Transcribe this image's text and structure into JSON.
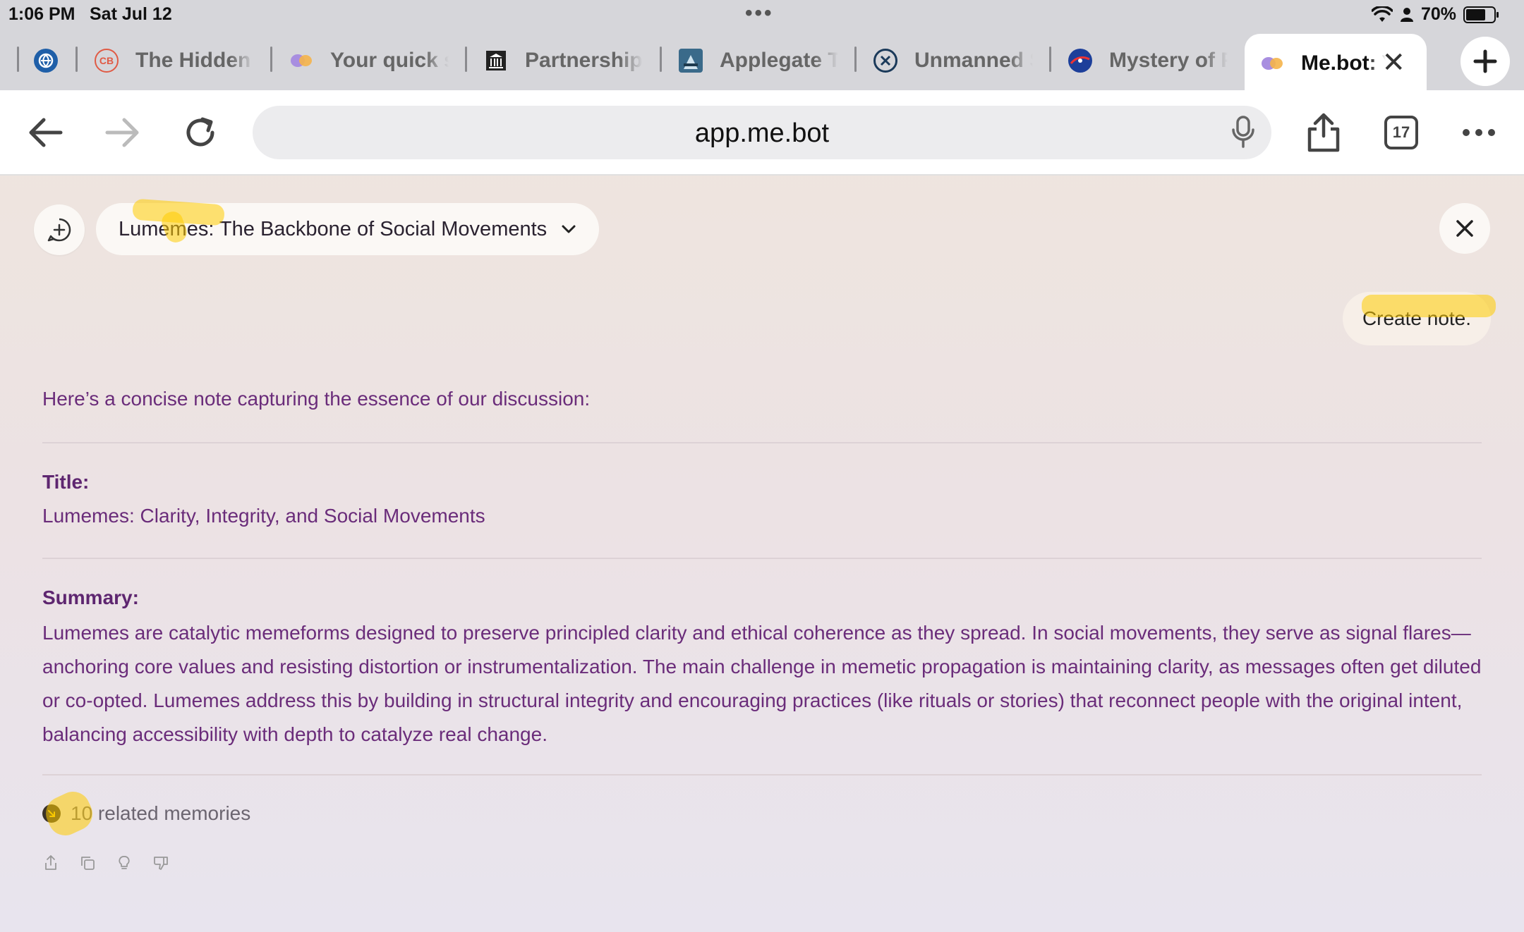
{
  "status": {
    "time": "1:06 PM",
    "date": "Sat Jul 12",
    "battery": "70%",
    "battery_level": 0.7
  },
  "tabs": [
    {
      "label": "",
      "favicon": "globe-shield-icon",
      "color": "#1f5fa8"
    },
    {
      "label": "The Hidden I",
      "favicon": "cb-badge-icon",
      "color": "#e05a44"
    },
    {
      "label": "Your quick s",
      "favicon": "mebot-logo-icon",
      "color": "#a88ee0"
    },
    {
      "label": "Partnership",
      "favicon": "building-icon",
      "color": "#222222"
    },
    {
      "label": "Applegate Ti",
      "favicon": "trail-badge-icon",
      "color": "#3a6a8a"
    },
    {
      "label": "Unmanned S",
      "favicon": "compass-icon",
      "color": "#1b3a5a"
    },
    {
      "label": "Mystery of P",
      "favicon": "nasa-logo-icon",
      "color": "#1d3f9a"
    },
    {
      "label": "Me.bot: Y",
      "favicon": "mebot-logo-icon",
      "color": "#a88ee0",
      "active": true
    }
  ],
  "toolbar": {
    "url": "app.me.bot",
    "tab_count": "17"
  },
  "app": {
    "topic": "Lumemes: The Backbone of Social Movements",
    "user_message": "Create note.",
    "intro": "Here’s a concise note capturing the essence of our discussion:",
    "title_label": "Title:",
    "title_value": "Lumemes: Clarity, Integrity, and Social Movements",
    "summary_label": "Summary:",
    "summary_text": "Lumemes are catalytic memeforms designed to preserve principled clarity and ethical coherence as they spread. In social movements, they serve as signal flares—anchoring core values and resisting distortion or instrumentalization. The main challenge in memetic propagation is maintaining clarity, as messages often get diluted or co-opted. Lumemes address this by building in structural integrity and encouraging practices (like rituals or stories) that reconnect people with the original intent, balancing accessibility with depth to catalyze real change.",
    "memories_count": "10",
    "memories_label": " related memories"
  },
  "colors": {
    "accent_text": "#6a2c7a",
    "highlight": "#ffcc00"
  }
}
